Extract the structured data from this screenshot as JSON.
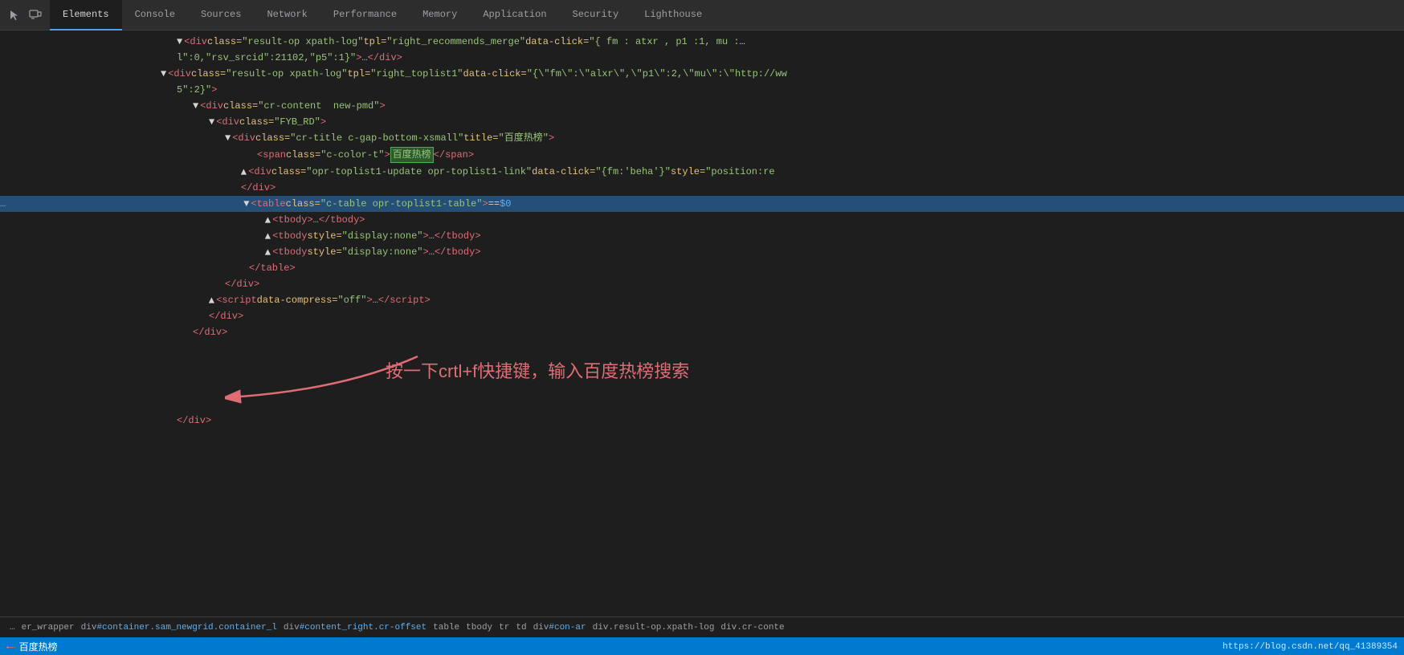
{
  "tabs": [
    {
      "label": "Elements",
      "active": true
    },
    {
      "label": "Console",
      "active": false
    },
    {
      "label": "Sources",
      "active": false
    },
    {
      "label": "Network",
      "active": false
    },
    {
      "label": "Performance",
      "active": false
    },
    {
      "label": "Memory",
      "active": false
    },
    {
      "label": "Application",
      "active": false
    },
    {
      "label": "Security",
      "active": false
    },
    {
      "label": "Lighthouse",
      "active": false
    }
  ],
  "elements": [
    {
      "indent": 180,
      "dots": false,
      "content": "&lt;div class=<span class='attr-val'>\"result-op xpath-log\"</span> tpl=<span class='attr-val'>\"right_recommends_merge\"</span> data-click=<span class='attr-val'>\"{fm:alxr,p1:1,mu:</span>",
      "raw": "line1"
    }
  ],
  "annotation": {
    "text": "按一下crtl+f快捷键，输入百度热榜搜索",
    "arrow": true
  },
  "breadcrumb": {
    "items": [
      {
        "text": "er_wrapper",
        "id": null,
        "class": null
      },
      {
        "text": "div",
        "id": "container.sam_newgrid.container_l",
        "class": null
      },
      {
        "text": "div",
        "id": "content_right.cr-offset",
        "class": null
      },
      {
        "text": "table",
        "id": null,
        "class": null
      },
      {
        "text": "tbody",
        "id": null,
        "class": null
      },
      {
        "text": "tr",
        "id": null,
        "class": null
      },
      {
        "text": "td",
        "id": null,
        "class": null
      },
      {
        "text": "div",
        "id": "con-ar",
        "class": null
      },
      {
        "text": "div.result-op.xpath-log",
        "id": null,
        "class": null
      },
      {
        "text": "div.cr-conte",
        "id": null,
        "class": null
      }
    ]
  },
  "status": {
    "left_text": "百度热榜",
    "url": "https://blog.csdn.net/qq_41389354"
  }
}
